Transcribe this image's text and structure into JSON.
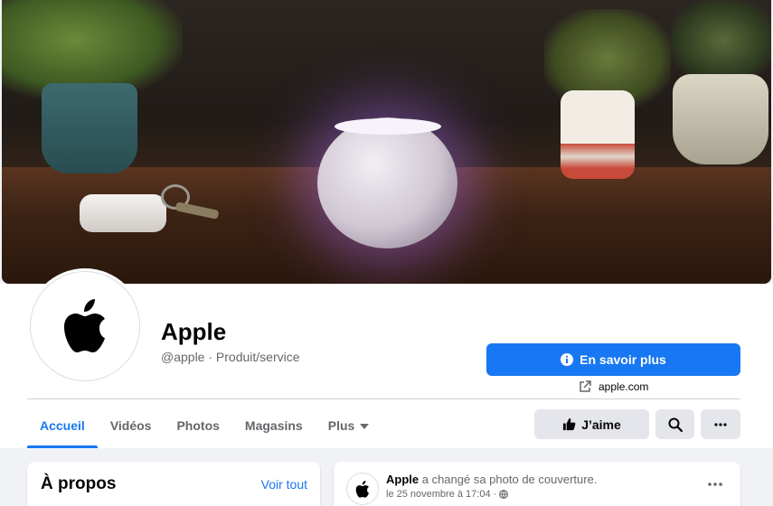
{
  "page": {
    "name": "Apple",
    "handle_category": "@apple · Produit/service"
  },
  "actions": {
    "cta_label": "En savoir plus",
    "website": "apple.com",
    "like_label": "J’aime"
  },
  "tabs": [
    {
      "label": "Accueil",
      "active": true
    },
    {
      "label": "Vidéos"
    },
    {
      "label": "Photos"
    },
    {
      "label": "Magasins"
    },
    {
      "label": "Plus"
    }
  ],
  "about": {
    "title": "À propos",
    "see_all": "Voir tout"
  },
  "post": {
    "author": "Apple",
    "action_text": " a changé sa photo de couverture.",
    "date": "le 25 novembre à 17:04 ·"
  },
  "colors": {
    "accent": "#1877f2",
    "background": "#f0f2f5",
    "button_gray": "#e4e6eb"
  }
}
